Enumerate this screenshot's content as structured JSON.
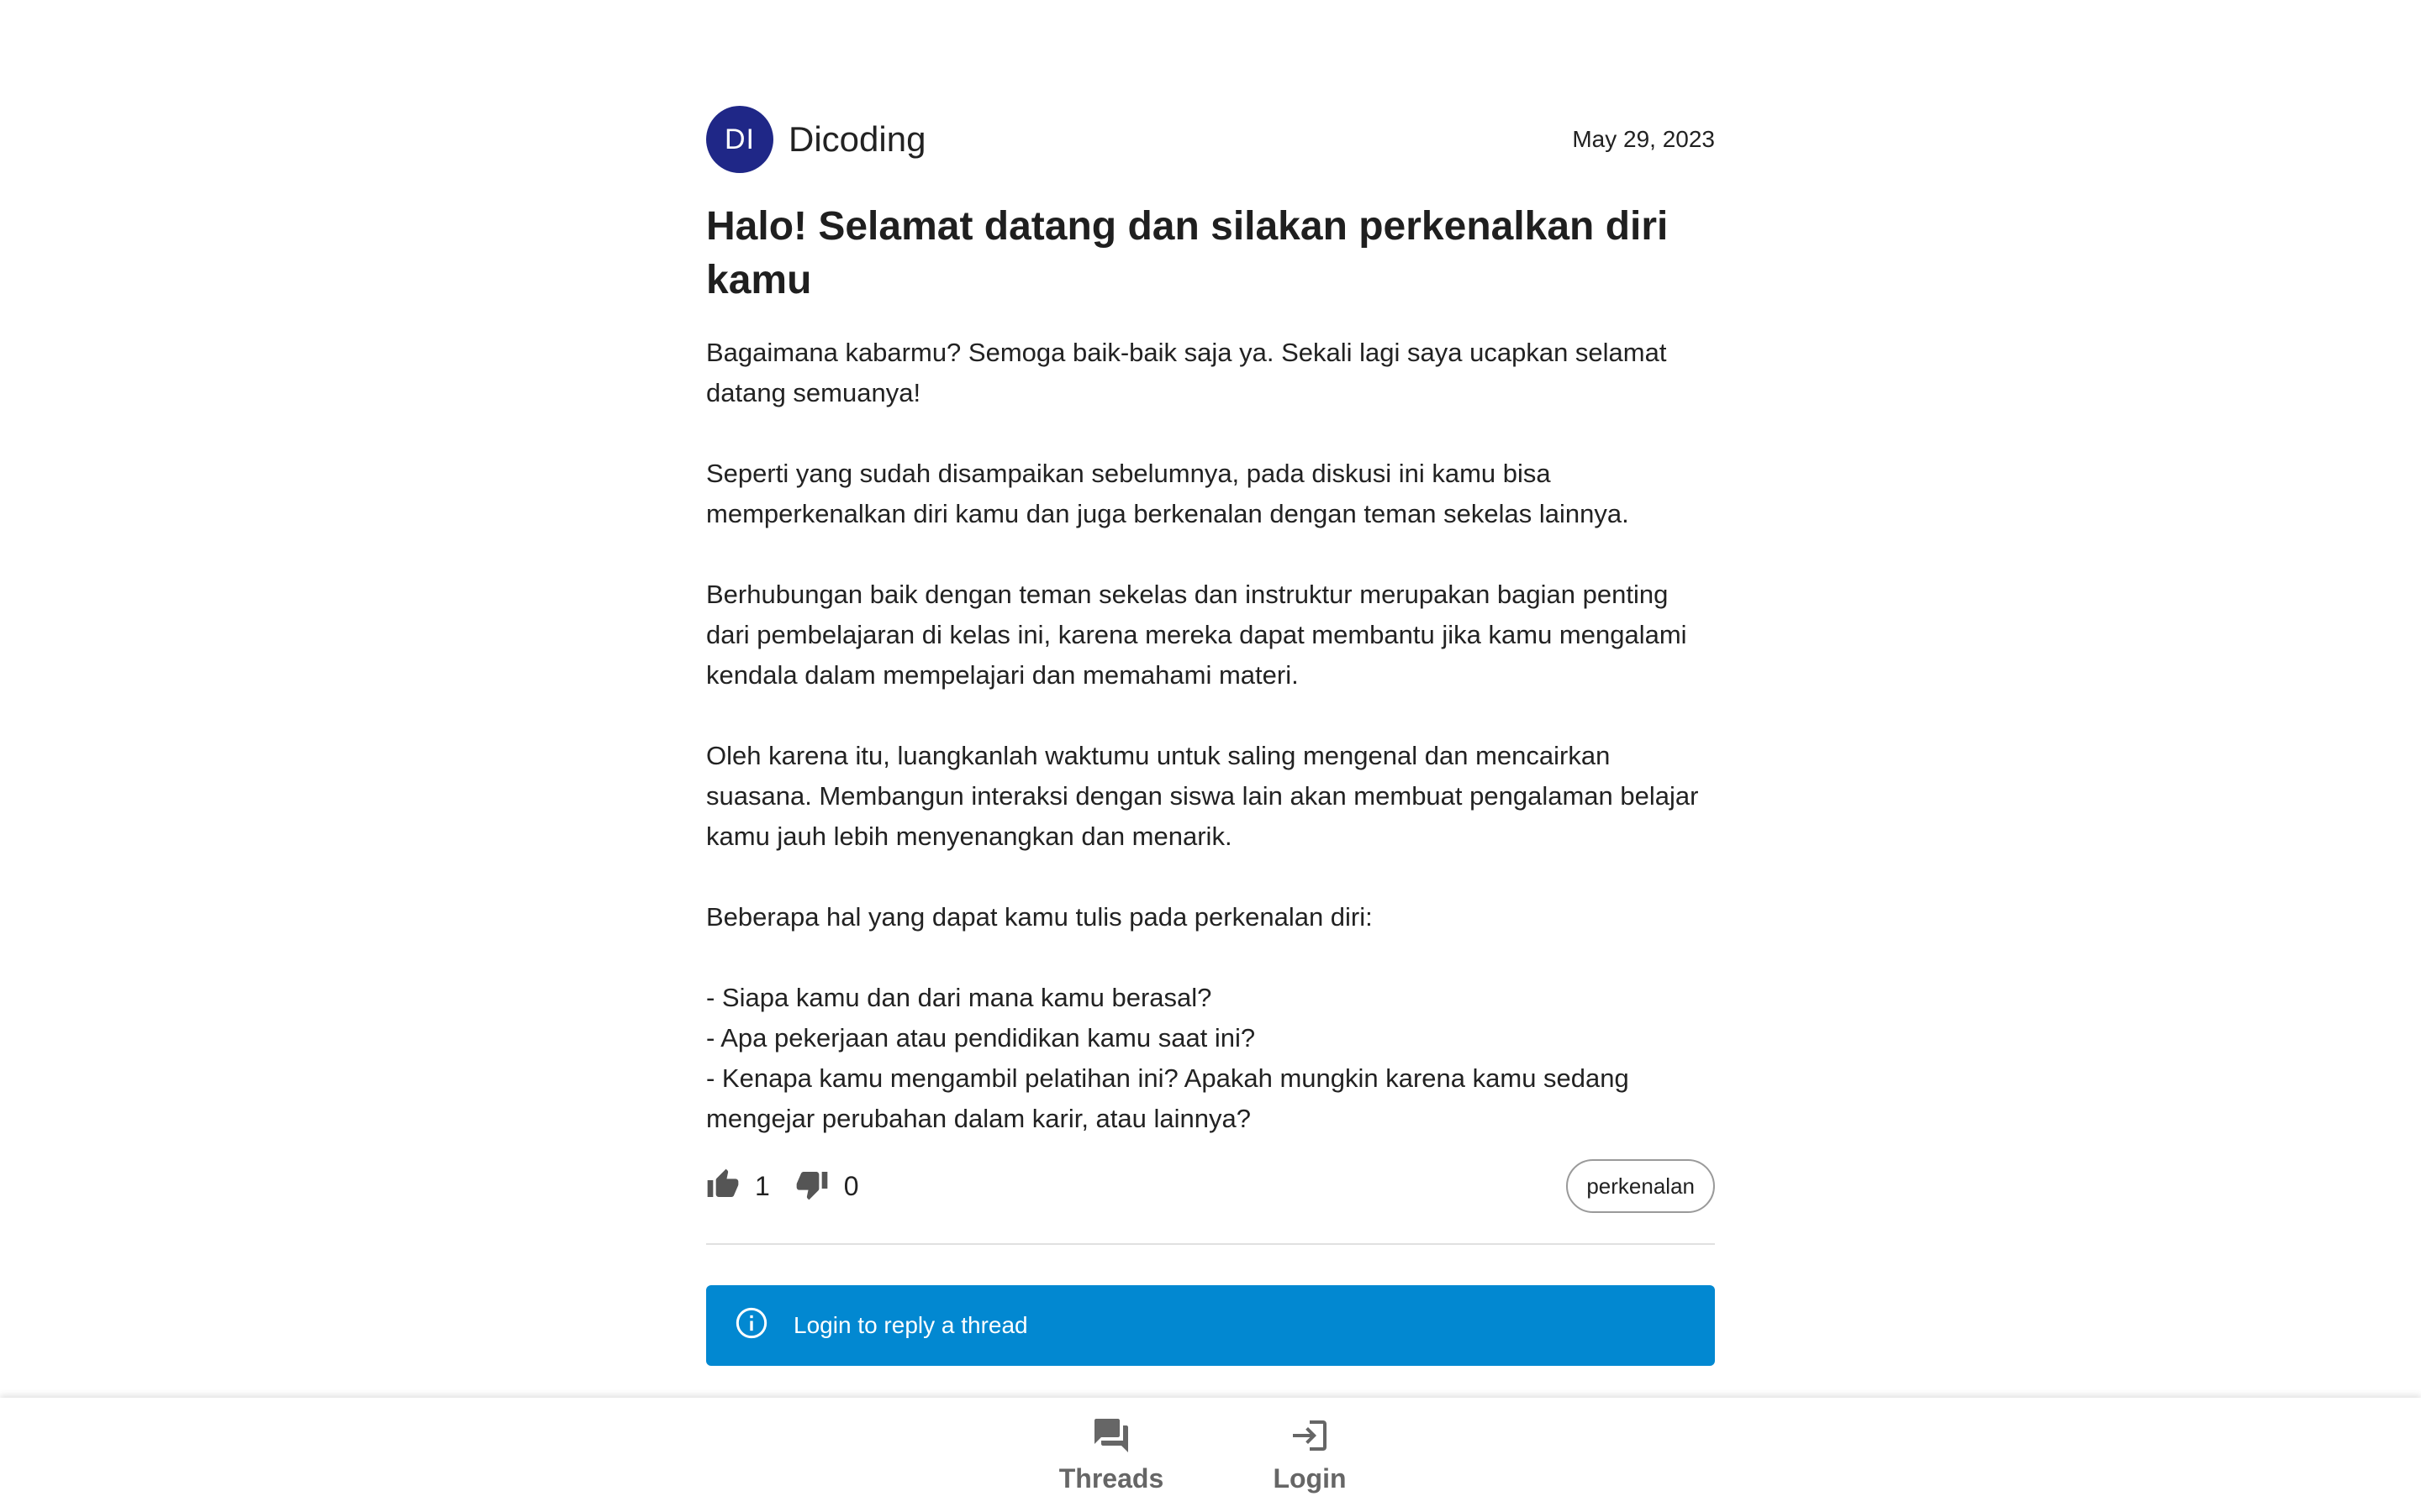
{
  "thread": {
    "author": {
      "initials": "DI",
      "name": "Dicoding",
      "avatar_color": "#1f2787"
    },
    "date": "May 29, 2023",
    "title": "Halo! Selamat datang dan silakan perkenalkan diri kamu",
    "body": {
      "p1": "Bagaimana kabarmu? Semoga baik-baik saja ya. Sekali lagi saya ucapkan selamat datang semuanya!",
      "p2": "Seperti yang sudah disampaikan sebelumnya, pada diskusi ini kamu bisa memperkenalkan diri kamu dan juga berkenalan dengan teman sekelas lainnya.",
      "p3": "Berhubungan baik dengan teman sekelas dan instruktur merupakan bagian penting dari pembelajaran di kelas ini, karena mereka dapat membantu jika kamu mengalami kendala dalam mempelajari dan memahami materi.",
      "p4": "Oleh karena itu, luangkanlah waktumu untuk saling mengenal dan mencairkan suasana. Membangun interaksi dengan siswa lain akan membuat pengalaman belajar kamu jauh lebih menyenangkan dan menarik.",
      "p5": "Beberapa hal yang dapat kamu tulis pada perkenalan diri:",
      "list": [
        "- Siapa kamu dan dari mana kamu berasal?",
        "- Apa pekerjaan atau pendidikan kamu saat ini?",
        "- Kenapa kamu mengambil pelatihan ini? Apakah mungkin karena kamu sedang mengejar perubahan dalam karir, atau lainnya?"
      ]
    },
    "upvotes": "1",
    "downvotes": "0",
    "tag": "perkenalan",
    "icons": {
      "upvote": "thumb-up-icon",
      "downvote": "thumb-down-icon"
    }
  },
  "login_notice": {
    "text": "Login to reply a thread",
    "icon": "info-icon",
    "color": "#0288d1"
  },
  "bottom_nav": {
    "items": [
      {
        "label": "Threads",
        "icon": "forum-icon"
      },
      {
        "label": "Login",
        "icon": "login-icon"
      }
    ]
  }
}
